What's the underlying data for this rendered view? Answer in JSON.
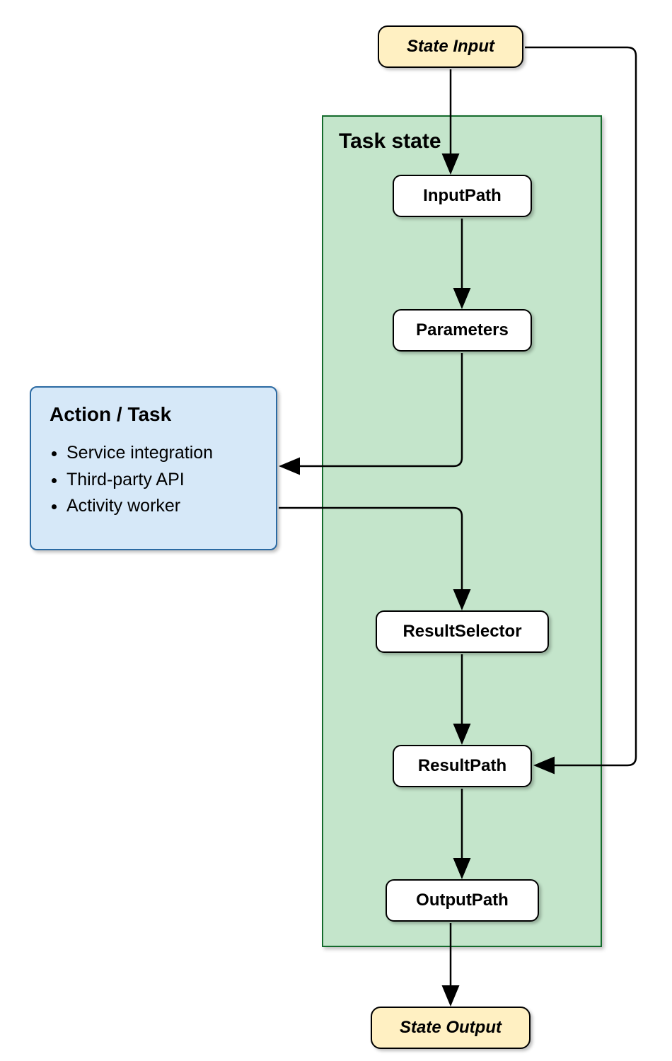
{
  "diagram": {
    "state_input": "State Input",
    "state_output": "State Output",
    "task_state_label": "Task state",
    "nodes": {
      "input_path": "InputPath",
      "parameters": "Parameters",
      "result_selector": "ResultSelector",
      "result_path": "ResultPath",
      "output_path": "OutputPath"
    },
    "action": {
      "title": "Action / Task",
      "items": [
        "Service integration",
        "Third-party API",
        "Activity worker"
      ]
    }
  },
  "colors": {
    "state_io_bg": "#fff0c2",
    "task_state_bg": "#c4e5cb",
    "task_state_border": "#146b2c",
    "action_bg": "#d6e8f8",
    "action_border": "#2b6aa3"
  }
}
